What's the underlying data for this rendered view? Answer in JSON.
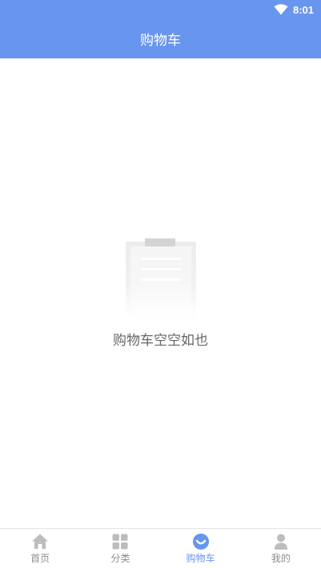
{
  "status_bar": {
    "time": "8:01",
    "wifi_icon": "wifi-icon"
  },
  "header": {
    "title": "购物车"
  },
  "empty_state": {
    "icon": "clipboard-icon",
    "message": "购物车空空如也"
  },
  "tabs": [
    {
      "label": "首页",
      "icon": "home-icon",
      "active": false
    },
    {
      "label": "分类",
      "icon": "grid-icon",
      "active": false
    },
    {
      "label": "购物车",
      "icon": "cart-icon",
      "active": true
    },
    {
      "label": "我的",
      "icon": "user-icon",
      "active": false
    }
  ],
  "colors": {
    "primary": "#6895ee",
    "tab_inactive": "#8e8e8e",
    "icon_gray": "#bdbdbd"
  }
}
